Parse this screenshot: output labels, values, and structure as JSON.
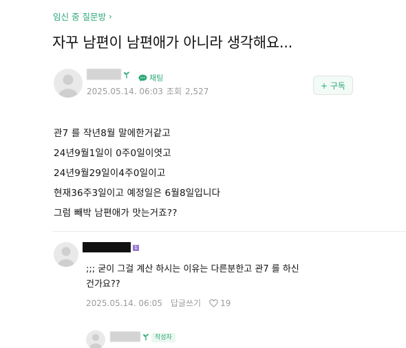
{
  "breadcrumb": {
    "label": "임신 중 질문방",
    "chevron": "chevron-right-icon"
  },
  "post": {
    "title": "자꾸 남편이 남편애가 아니라 생각해요...",
    "author": {
      "chat_badge": "채팅",
      "date": "2025.05.14. 06:03",
      "views_label": "조회",
      "views": "2,527"
    },
    "subscribe_label": "+ 구독",
    "body": [
      "관7  를 작년8월 말에한거같고",
      "24년9월1일이 0주0일이엿고",
      "24년9월29일이4주0일이고",
      "현재36주3일이고 예정일은 6월8일입니다",
      "그럼 빼박 남편애가 맛는거죠??"
    ]
  },
  "comment": {
    "rank_badge": "1",
    "text": ";;; 굳이 그걸 계산 하시는 이유는 다른분한고 관7  를 하신 건가요??",
    "date": "2025.05.14. 06:05",
    "reply_label": "답글쓰기",
    "likes": "19"
  },
  "reply": {
    "author_tag": "작성자"
  },
  "colors": {
    "accent": "#2aa876",
    "meta": "#9b9b9b",
    "rank": "#9b7bd4"
  }
}
